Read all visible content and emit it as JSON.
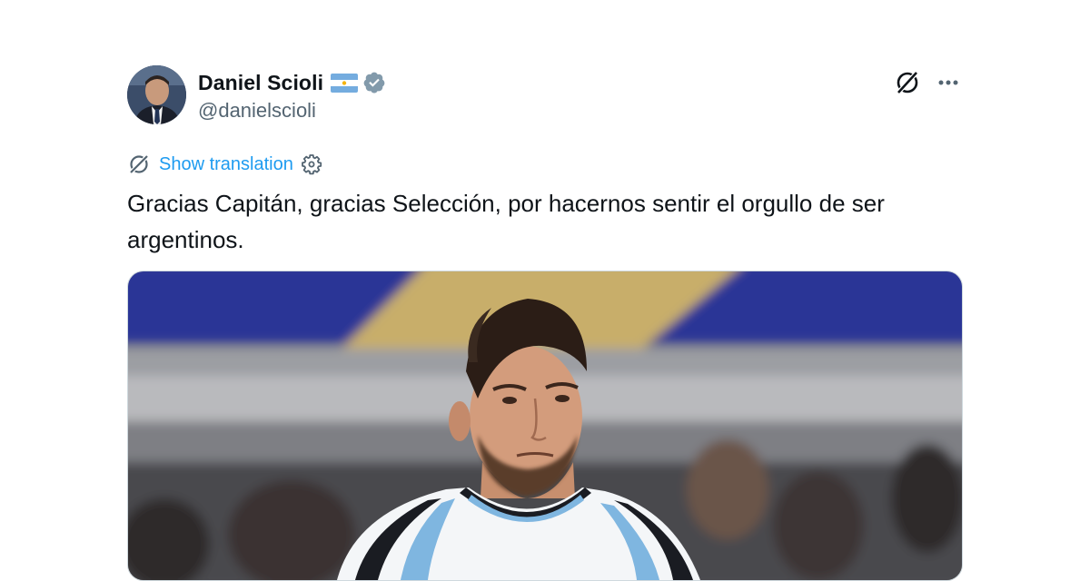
{
  "author": {
    "display_name": "Daniel Scioli",
    "handle": "@danielscioli",
    "flag": "argentina-flag",
    "verified_badge": "verified-badge-icon"
  },
  "actions": {
    "logo_icon": "x-logo-icon",
    "more_icon": "more-options-icon"
  },
  "translation": {
    "icon": "translate-icon",
    "link_label": "Show translation",
    "settings_icon": "gear-icon"
  },
  "tweet": {
    "text": "Gracias Capitán, gracias Selección, por hacernos sentir el orgullo de ser argentinos."
  },
  "colors": {
    "link": "#1d9bf0",
    "secondary_text": "#536471",
    "primary_text": "#0f1419",
    "verified_gray": "#829aab"
  }
}
